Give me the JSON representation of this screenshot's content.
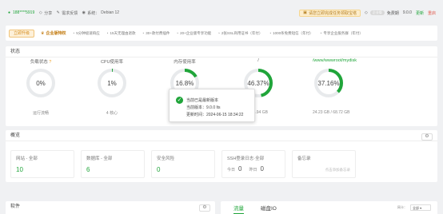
{
  "topbar": {
    "user": "188****5919",
    "pay": "分享",
    "renew": "需求反馈",
    "system_label": "系统：",
    "system": "Debian 12",
    "notice": "请您立即完成任务领取宝塔",
    "badge": "企业版",
    "expire": "免费期",
    "version": "9.0.0",
    "update": "更新",
    "restart": "重启"
  },
  "feature": {
    "tag": "立即升级",
    "title": "企业版特权",
    "items": [
      {
        "icon": "shield-icon",
        "label": "5分钟极速响应"
      },
      {
        "icon": "refund-icon",
        "label": "15天无理由退款"
      },
      {
        "icon": "plugin-icon",
        "label": "30+款付费插件"
      },
      {
        "icon": "plus-icon",
        "label": "20+企业版专享功能"
      },
      {
        "icon": "ssl-icon",
        "label": "2张SSL商用证书（年付）"
      },
      {
        "icon": "sms-icon",
        "label": "1000条免费短信（年付）"
      },
      {
        "icon": "service-icon",
        "label": "专享企业服务群（年付）"
      }
    ]
  },
  "status": {
    "title": "状态",
    "gauges": [
      {
        "title": "负载状态",
        "value": "0%",
        "sub": "运行流畅",
        "percent": 0,
        "color": "#20a53a",
        "help": "?"
      },
      {
        "title": "CPU使用率",
        "value": "1%",
        "sub": "4 核心",
        "percent": 1,
        "color": "#20a53a"
      },
      {
        "title": "内存使用率",
        "value": "16.8%",
        "sub": "",
        "percent": 16.8,
        "color": "#20a53a"
      },
      {
        "title": "/",
        "value": "46.37%",
        "sub": "/ 58.94 GB",
        "percent": 46.37,
        "color": "#20a53a"
      },
      {
        "title": "/www/wwwroot/mydisk",
        "value": "37.16%",
        "sub": "24.23 GB / 68.72 GB",
        "percent": 37.16,
        "color": "#20a53a"
      }
    ]
  },
  "popup": {
    "title": "当前已是最新版本",
    "version": "当前版本：9.0.0 lts",
    "time": "更新时间：2024-06-15 18:34:22"
  },
  "overview": {
    "title": "概览",
    "cards": [
      {
        "label": "网站 - 全部",
        "value": "10"
      },
      {
        "label": "数据库 - 全部",
        "value": "6"
      },
      {
        "label": "安全风险",
        "value": "0"
      },
      {
        "label": "SSH登录日志·全部",
        "today_label": "今日",
        "today": "0",
        "yesterday_label": "昨日",
        "yesterday": "0"
      },
      {
        "label": "备忘录",
        "hint": "点击添加备忘录"
      }
    ]
  },
  "software": {
    "title": "软件"
  },
  "traffic": {
    "tabs": [
      "流量",
      "磁盘IO"
    ],
    "net_label": "网卡：",
    "net_value": "全部"
  }
}
